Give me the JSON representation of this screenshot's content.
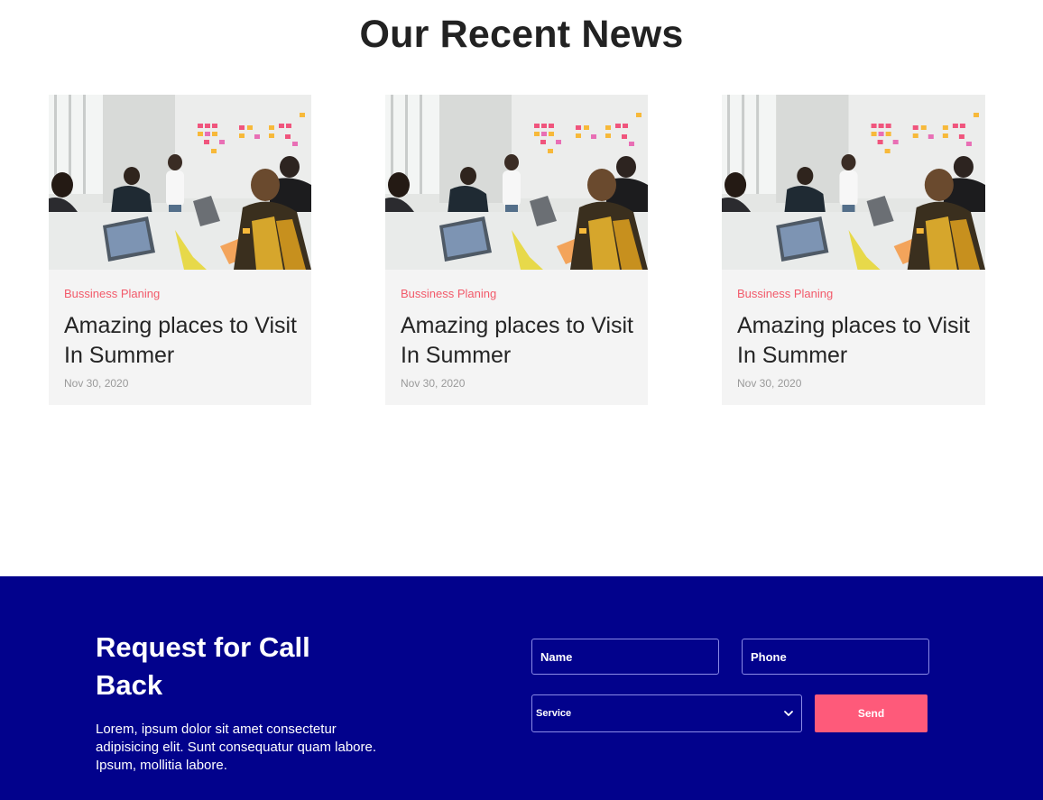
{
  "news": {
    "title": "Our Recent News",
    "cards": [
      {
        "category": "Bussiness Planing",
        "title": "Amazing places to Visit In Summer",
        "date": "Nov 30, 2020"
      },
      {
        "category": "Bussiness Planing",
        "title": "Amazing places to Visit In Summer",
        "date": "Nov 30, 2020"
      },
      {
        "category": "Bussiness Planing",
        "title": "Amazing places to Visit In Summer",
        "date": "Nov 30, 2020"
      }
    ]
  },
  "callback": {
    "title": "Request for Call Back",
    "text": "Lorem, ipsum dolor sit amet consectetur adipisicing elit. Sunt consequatur quam labore. Ipsum, mollitia labore.",
    "name_placeholder": "Name",
    "phone_placeholder": "Phone",
    "service_selected": "Service",
    "send_label": "Send"
  },
  "colors": {
    "accent": "#fe5a7a",
    "category": "#f25a6a",
    "callback_bg": "#02028c",
    "card_bg": "#f4f4f4"
  }
}
